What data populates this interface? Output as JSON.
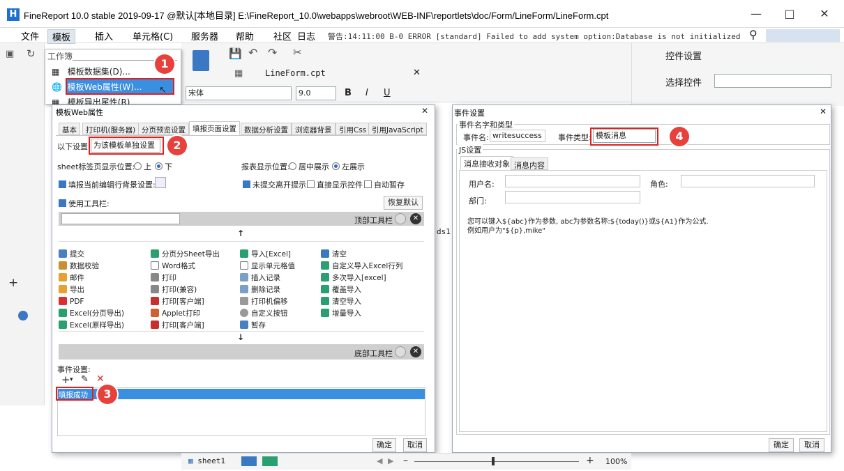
{
  "app": {
    "title": "FineReport 10.0 stable 2019-09-17 @默认[本地目录]    E:\\FineReport_10.0\\webapps\\webroot\\WEB-INF\\reportlets\\doc/Form/LineForm/LineForm.cpt",
    "logo": "H"
  },
  "menu": {
    "items": [
      "文件",
      "模板",
      "插入",
      "单元格(C)",
      "服务器",
      "帮助",
      "社区",
      "日志"
    ],
    "log": "警告:14:11:00 B-0 ERROR [standard] Failed to add system option:Database is not initialized"
  },
  "context_menu": {
    "header": "工作簿",
    "items": [
      "模板数据集(D)...",
      "模板Web属性(W)...",
      "模板导出属性(R)"
    ]
  },
  "editor": {
    "file_tab": "LineForm.cpt",
    "font": "宋体",
    "size": "9.0",
    "cell_text": "ds1"
  },
  "right_panel": {
    "title": "控件设置",
    "select_label": "选择控件"
  },
  "web_dialog": {
    "title": "模板Web属性",
    "tabs": [
      "基本",
      "打印机(服务器)",
      "分页预览设置",
      "填报页面设置",
      "数据分析设置",
      "浏览器背景",
      "引用Css",
      "引用JavaScript"
    ],
    "setting_label": "以下设置:",
    "setting_value": "为该模板单独设置",
    "sheet_pos_label": "sheet标签页显示位置:",
    "sheet_pos_top": "上",
    "sheet_pos_bottom": "下",
    "report_pos_label": "报表显示位置:",
    "report_center": "居中展示",
    "report_left": "左展示",
    "fill_bg": "填报当前编辑行背景设置:",
    "unsubmitted": "未提交离开提示",
    "show_widget": "直接显示控件",
    "auto_save": "自动暂存",
    "use_toolbar": "使用工具栏:",
    "restore": "恢复默认",
    "top_toolbar": "顶部工具栏",
    "bottom_toolbar": "底部工具栏",
    "arrow_up": "↑",
    "arrow_down": "↓",
    "tools": [
      [
        "提交",
        "分页分Sheet导出",
        "导入[Excel]",
        "清空"
      ],
      [
        "数据校验",
        "Word格式",
        "显示单元格值",
        "自定义导入Excel行列"
      ],
      [
        "邮件",
        "打印",
        "插入记录",
        "多次导入[excel]"
      ],
      [
        "导出",
        "打印(兼容)",
        "删除记录",
        "覆盖导入"
      ],
      [
        "PDF",
        "打印[客户端]",
        "打印机偏移",
        "清空导入"
      ],
      [
        "Excel(分页导出)",
        "Applet打印",
        "自定义按钮",
        "增量导入"
      ],
      [
        "Excel(原样导出)",
        "打印[客户端]",
        "暂存",
        ""
      ]
    ],
    "event_label": "事件设置:",
    "event_item": "填报成功",
    "ok": "确定",
    "cancel": "取消"
  },
  "event_dialog": {
    "title": "事件设置",
    "group1": "事件名字和类型",
    "name_label": "事件名:",
    "name_value": "writesuccess",
    "type_label": "事件类型:",
    "type_value": "模板消息",
    "group2": "JS设置",
    "tabs": [
      "消息接收对象",
      "消息内容"
    ],
    "user_label": "用户名:",
    "role_label": "角色:",
    "dept_label": "部门:",
    "hint1": "您可以键入${abc}作为参数, abc为参数名称:${today()}或${A1}作为公式.",
    "hint2": "例如用户为\"${p},mike\"",
    "ok": "确定",
    "cancel": "取消"
  },
  "sheetbar": {
    "sheet": "sheet1",
    "zoom": "100%"
  },
  "badges": [
    "1",
    "2",
    "3",
    "4"
  ],
  "colors": {
    "accent": "#1e6fd0",
    "highlight": "#e02020",
    "selection": "#3b8fe0"
  }
}
